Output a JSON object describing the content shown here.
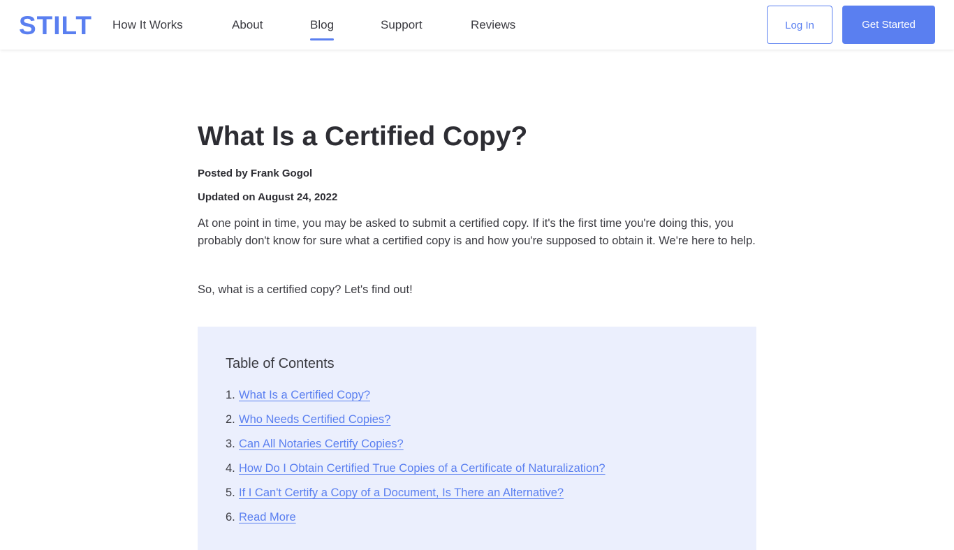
{
  "header": {
    "logo": "STILT",
    "nav": [
      {
        "label": "How It Works",
        "active": false
      },
      {
        "label": "About",
        "active": false
      },
      {
        "label": "Blog",
        "active": true
      },
      {
        "label": "Support",
        "active": false
      },
      {
        "label": "Reviews",
        "active": false
      }
    ],
    "login_label": "Log In",
    "get_started_label": "Get Started"
  },
  "article": {
    "title": "What Is a Certified Copy?",
    "posted_by": "Posted by Frank Gogol",
    "updated_on": "Updated on August 24, 2022",
    "paragraphs": [
      "At one point in time, you may be asked to submit a certified copy. If it's the first time you're doing this, you probably don't know for sure what a certified copy is and how you're supposed to obtain it. We're here to help.",
      "So, what is a certified copy? Let's find out!"
    ]
  },
  "toc": {
    "title": "Table of Contents",
    "items": [
      {
        "number": "1.",
        "label": "What Is a Certified Copy?"
      },
      {
        "number": "2.",
        "label": "Who Needs Certified Copies?"
      },
      {
        "number": "3.",
        "label": "Can All Notaries Certify Copies?"
      },
      {
        "number": "4.",
        "label": "How Do I Obtain Certified True Copies of a Certificate of Naturalization?"
      },
      {
        "number": "5.",
        "label": "If I Can't Certify a Copy of a Document, Is There an Alternative?"
      },
      {
        "number": "6.",
        "label": "Read More"
      }
    ]
  },
  "colors": {
    "brand": "#5a7ff0",
    "toc_background": "#ebeffd",
    "text": "#2d2d33"
  }
}
